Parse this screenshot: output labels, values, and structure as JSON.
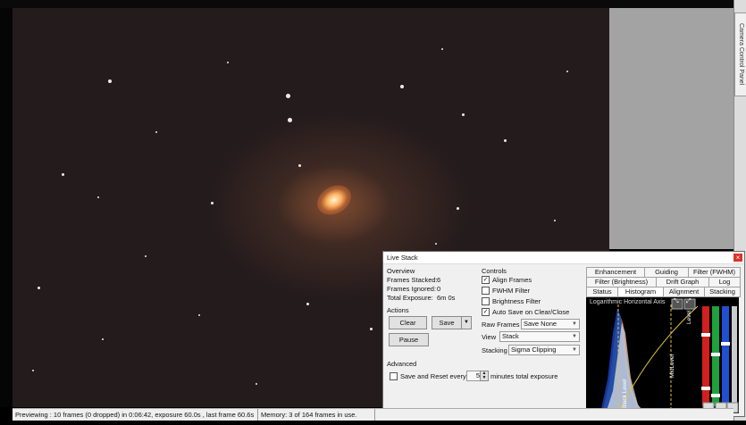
{
  "side_panel": {
    "tab_label": "Camera Control Panel"
  },
  "status": {
    "previewing": "Previewing : 10 frames (0 dropped) in 0:06:42, exposure 60.0s , last frame 60.6s",
    "memory": "Memory: 3 of 164 frames in use."
  },
  "dialog": {
    "title": "Live Stack",
    "overview": {
      "heading": "Overview",
      "frames_stacked_label": "Frames Stacked:",
      "frames_stacked": "6",
      "frames_ignored_label": "Frames Ignored:",
      "frames_ignored": "0",
      "total_exposure_label": "Total Exposure:",
      "total_exposure": "6m 0s"
    },
    "actions": {
      "heading": "Actions",
      "clear": "Clear",
      "save": "Save",
      "pause": "Pause"
    },
    "controls": {
      "heading": "Controls",
      "align_frames": "Align Frames",
      "fwhm_filter": "FWHM Filter",
      "brightness_filter": "Brightness Filter",
      "auto_save": "Auto Save on Clear/Close",
      "raw_frames_label": "Raw Frames",
      "raw_frames_value": "Save None",
      "view_label": "View",
      "view_value": "Stack",
      "stacking_label": "Stacking",
      "stacking_value": "Sigma Clipping"
    },
    "advanced": {
      "heading": "Advanced",
      "save_reset_label": "Save and Reset every",
      "save_reset_value": "5",
      "save_reset_suffix": "minutes total exposure"
    },
    "tabs_row1": [
      "Enhancement",
      "Guiding",
      "Filter (FWHM)"
    ],
    "tabs_row2": [
      "Filter (Brightness)",
      "Drift Graph",
      "Log"
    ],
    "tabs_row3": [
      "Status",
      "Histogram",
      "Alignment",
      "Stacking"
    ],
    "histogram": {
      "axis_label": "Logarithmic Horizontal Axis",
      "level_label_1": "Level",
      "mid_level_label": "MidLevel",
      "black_level_label": "Black Level"
    }
  }
}
